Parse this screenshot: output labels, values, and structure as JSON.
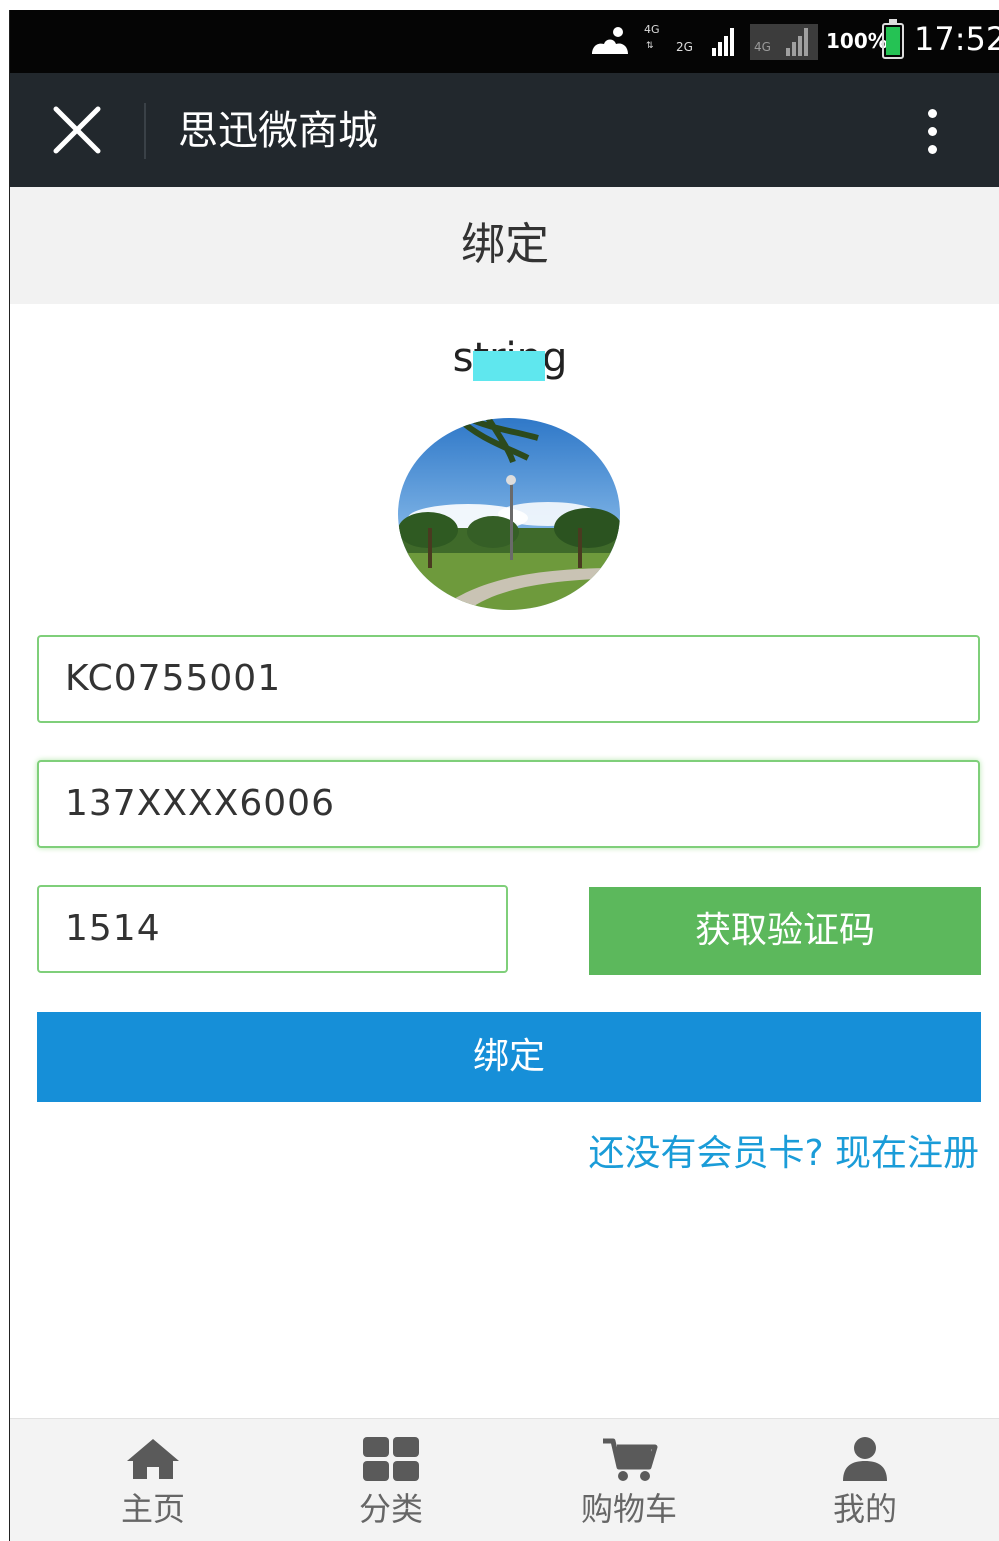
{
  "status_bar": {
    "network_top": "4G",
    "network_2g": "2G",
    "network_4g": "4G",
    "battery": "100%",
    "time": "17:52"
  },
  "header": {
    "title": "思迅微商城"
  },
  "page": {
    "title": "绑定",
    "username": "string"
  },
  "form": {
    "card_number": "KC0755001",
    "phone": "137XXXX6006",
    "code": "1514",
    "get_code_label": "获取验证码",
    "bind_label": "绑定",
    "register_link": "还没有会员卡? 现在注册"
  },
  "bottom_nav": {
    "items": [
      {
        "label": "主页",
        "icon": "home-icon"
      },
      {
        "label": "分类",
        "icon": "grid-icon"
      },
      {
        "label": "购物车",
        "icon": "cart-icon"
      },
      {
        "label": "我的",
        "icon": "user-icon"
      }
    ]
  },
  "colors": {
    "header_bg": "#22282d",
    "green": "#5cb85c",
    "blue": "#168fd8",
    "link": "#1a9cd8"
  }
}
